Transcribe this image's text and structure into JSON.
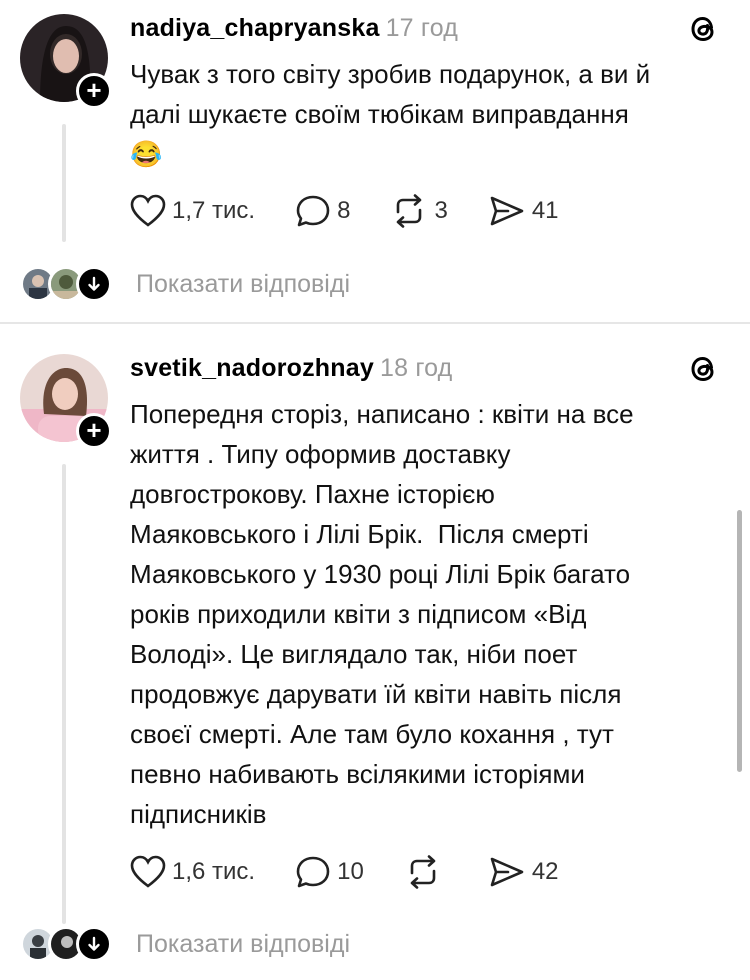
{
  "posts": [
    {
      "username": "nadiya_chapryanska",
      "time": "17 год",
      "text_lines": [
        "Чувак з того світу зробив подарунок, а ви й",
        "далі шукаєте своїм тюбікам виправдання",
        "😂"
      ],
      "likes": "1,7 тис.",
      "comments": "8",
      "reposts": "3",
      "shares": "41",
      "replies_label": "Показати відповіді"
    },
    {
      "username": "svetik_nadorozhnay",
      "time": "18 год",
      "text_lines": [
        "Попередня сторіз, написано : квіти на все",
        "життя . Типу оформив доставку",
        "довгострокову. Пахне історією",
        "Маяковського і Лілі Брік.  Після смерті",
        "Маяковського у 1930 році Лілі Брік багато",
        "років приходили квіти з підписом «Від",
        "Володі». Це виглядало так, ніби поет",
        "продовжує дарувати їй квіти навіть після",
        "своєї смерті. Але там було кохання , тут",
        "певно набивають всілякими історіями",
        "підписників"
      ],
      "likes": "1,6 тис.",
      "comments": "10",
      "reposts": "",
      "shares": "42",
      "replies_label": "Показати відповіді"
    }
  ],
  "icons": {
    "like": "heart-icon",
    "comment": "comment-bubble-icon",
    "repost": "repost-icon",
    "share": "share-send-icon",
    "app": "threads-logo-icon",
    "follow": "plus-icon",
    "expand": "arrow-down-icon"
  },
  "colors": {
    "text": "#111111",
    "muted": "#9a9a9a",
    "divider": "#e6e6e6",
    "accent": "#000000"
  }
}
